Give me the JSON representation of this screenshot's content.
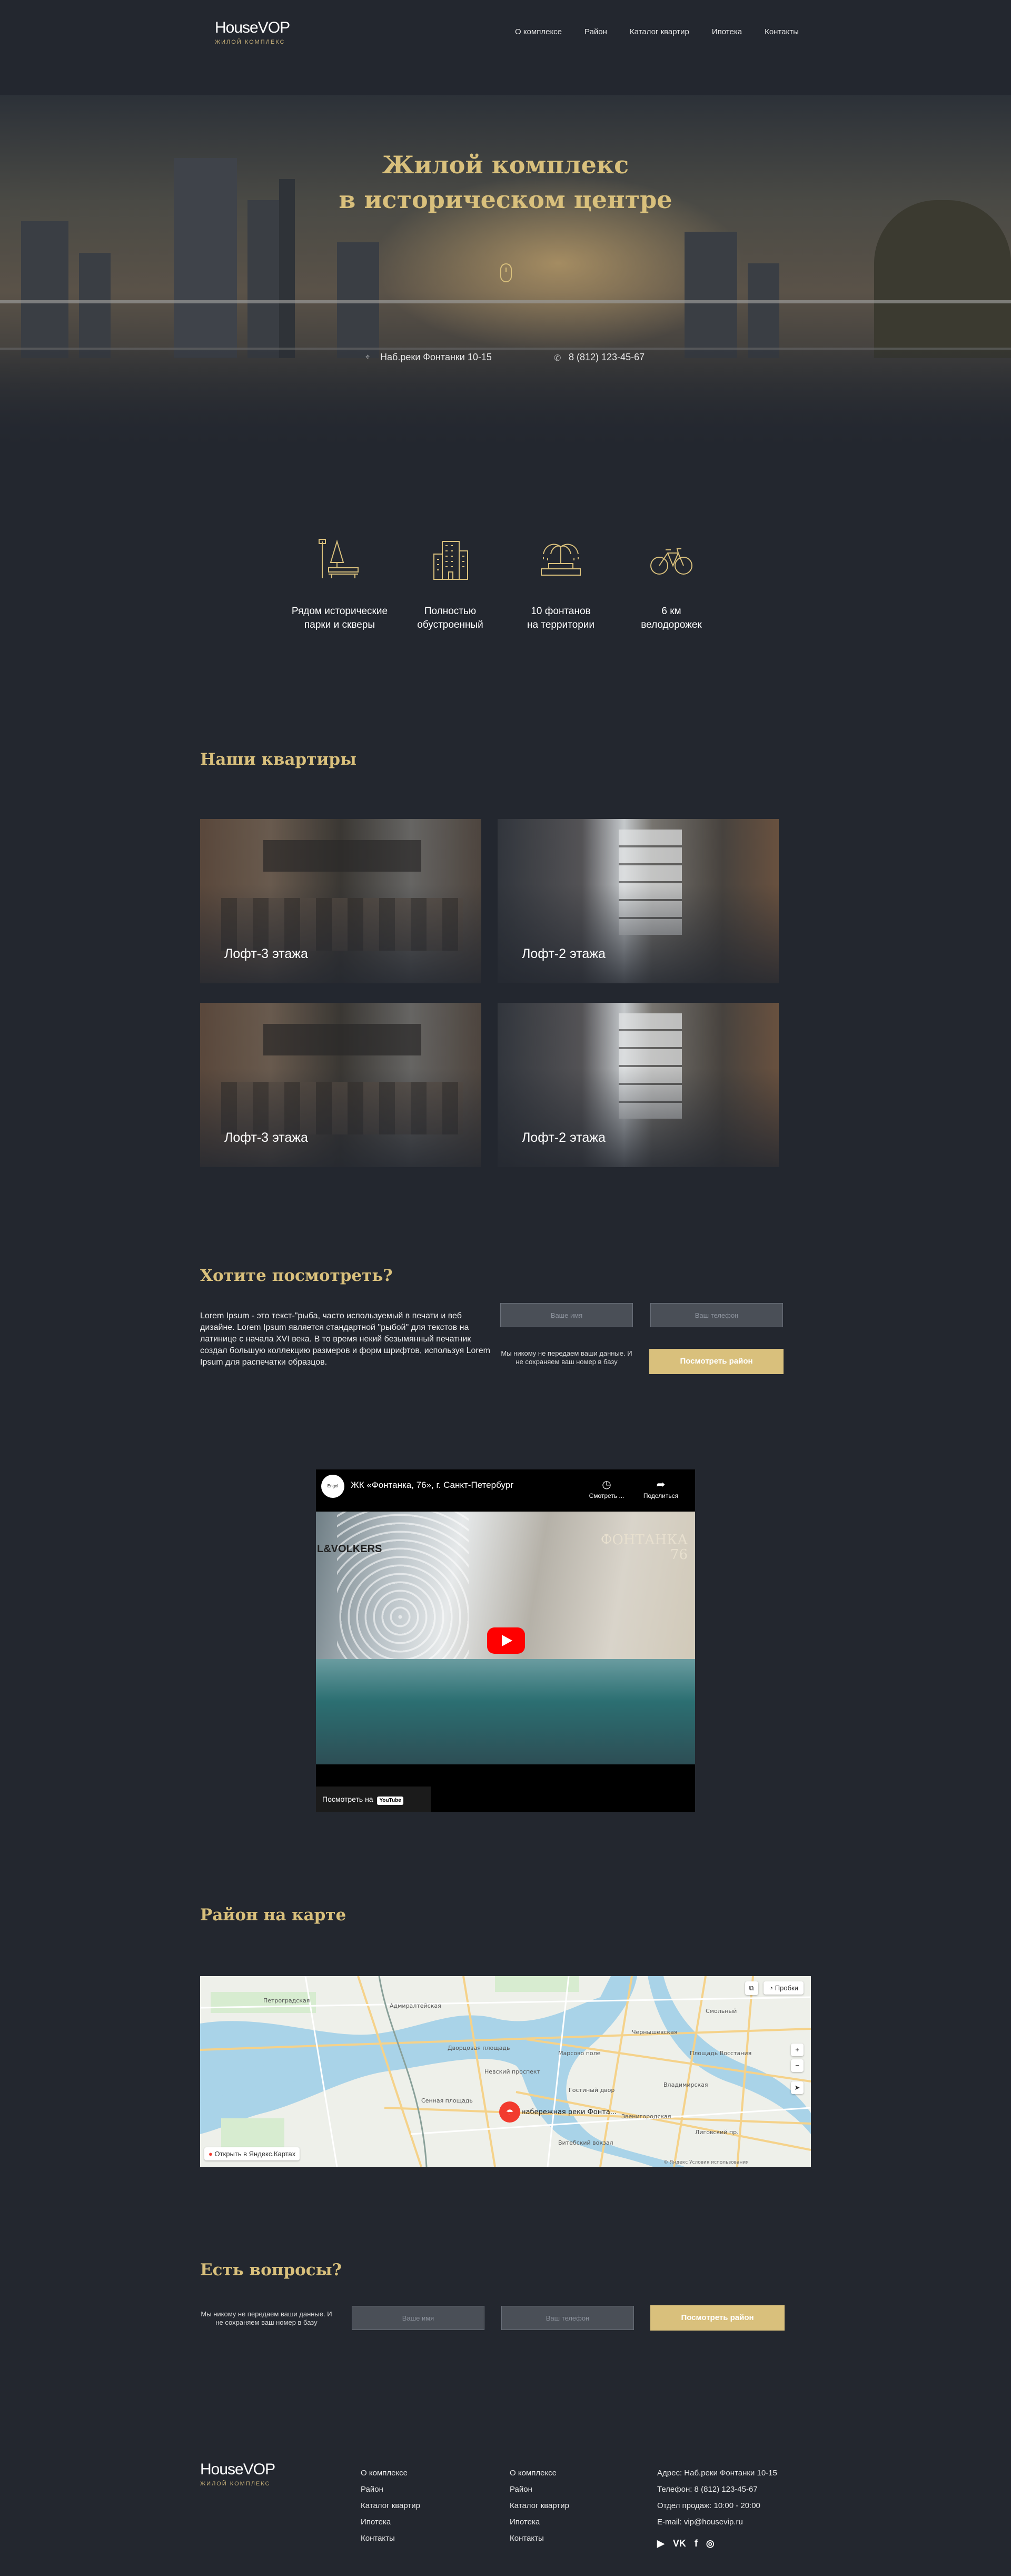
{
  "brand": {
    "name": "HouseVOP",
    "tagline": "ЖИЛОЙ КОМПЛЕКС"
  },
  "nav": [
    "О комплексе",
    "Район",
    "Каталог квартир",
    "Ипотека",
    "Контакты"
  ],
  "hero": {
    "title_line1": "Жилой комплекс",
    "title_line2": "в историческом центре",
    "address": "Наб.реки Фонтанки 10-15",
    "phone": "8 (812) 123-45-67"
  },
  "features": [
    {
      "icon": "park-bench-icon",
      "text1": "Рядом исторические",
      "text2": "парки и скверы"
    },
    {
      "icon": "building-icon",
      "text1": "Полностью",
      "text2": "обустроенный"
    },
    {
      "icon": "fountain-icon",
      "text1": "10 фонтанов",
      "text2": "на территории"
    },
    {
      "icon": "bicycle-icon",
      "text1": "6 км",
      "text2": "велодорожек"
    }
  ],
  "apartments": {
    "title": "Наши квартиры",
    "items": [
      "Лофт-3 этажа",
      "Лофт-2 этажа",
      "Лофт-3 этажа",
      "Лофт-2 этажа"
    ]
  },
  "viewing": {
    "title": "Хотите посмотреть?",
    "text": "Lorem Ipsum - это текст-\"рыба, часто используемый в печати и веб дизайне. Lorem Ipsum является стандартной \"рыбой\" для текстов на латинице с начала XVI века. В то время некий безымянный печатник создал большую коллекцию размеров и форм шрифтов, используя Lorem Ipsum для распечатки образцов.",
    "name_placeholder": "Ваше имя",
    "phone_placeholder": "Ваш телефон",
    "note": "Мы никому не передаем ваши данные. И не сохраняем ваш номер в базу",
    "button": "Посмотреть район"
  },
  "video": {
    "channel": "Engel",
    "title": "ЖК «Фонтанка, 76», г. Санкт-Петербург",
    "watch_later": "Смотреть ...",
    "share": "Поделиться",
    "brand_left": "L&VOLKERS",
    "brand_right_1": "ФОНТАНКА",
    "brand_right_2": "76",
    "watch_on": "Посмотреть на",
    "youtube": "YouTube"
  },
  "map": {
    "title": "Район на карте",
    "traffic": "Пробки",
    "open_in": "Открыть в Яндекс.Картах",
    "marker_label": "набережная реки Фонта...",
    "copyright": "© Яндекс   Условия использования",
    "places": [
      "Дворцовая площадь",
      "Невский проспект",
      "Гостиный двор",
      "Марсово поле",
      "Витебский вокзал",
      "Звенигородская",
      "Сенная площадь",
      "Владимирская",
      "Лиговский пр.",
      "Площадь Восстания",
      "Смольный",
      "Чернышевская",
      "Петроградская",
      "Адмиралтейская"
    ]
  },
  "questions": {
    "title": "Есть вопросы?",
    "note": "Мы никому не передаем ваши данные. И не сохраняем ваш номер в базу",
    "name_placeholder": "Ваше имя",
    "phone_placeholder": "Ваш телефон",
    "button": "Посмотреть район"
  },
  "footer": {
    "col1": [
      "О комплексе",
      "Район",
      "Каталог квартир",
      "Ипотека",
      "Контакты"
    ],
    "col2": [
      "О комплексе",
      "Район",
      "Каталог квартир",
      "Ипотека",
      "Контакты"
    ],
    "contacts": [
      "Адрес: Наб.реки Фонтанки 10-15",
      "Телефон: 8 (812) 123-45-67",
      "Отдел продаж: 10:00 - 20:00",
      "E-mail: vip@housevip.ru"
    ],
    "social": [
      "youtube-icon",
      "vk-icon",
      "facebook-icon",
      "instagram-icon"
    ]
  },
  "colors": {
    "background": "#23272f",
    "accent": "#d9c07c",
    "input": "#4a4f57"
  }
}
